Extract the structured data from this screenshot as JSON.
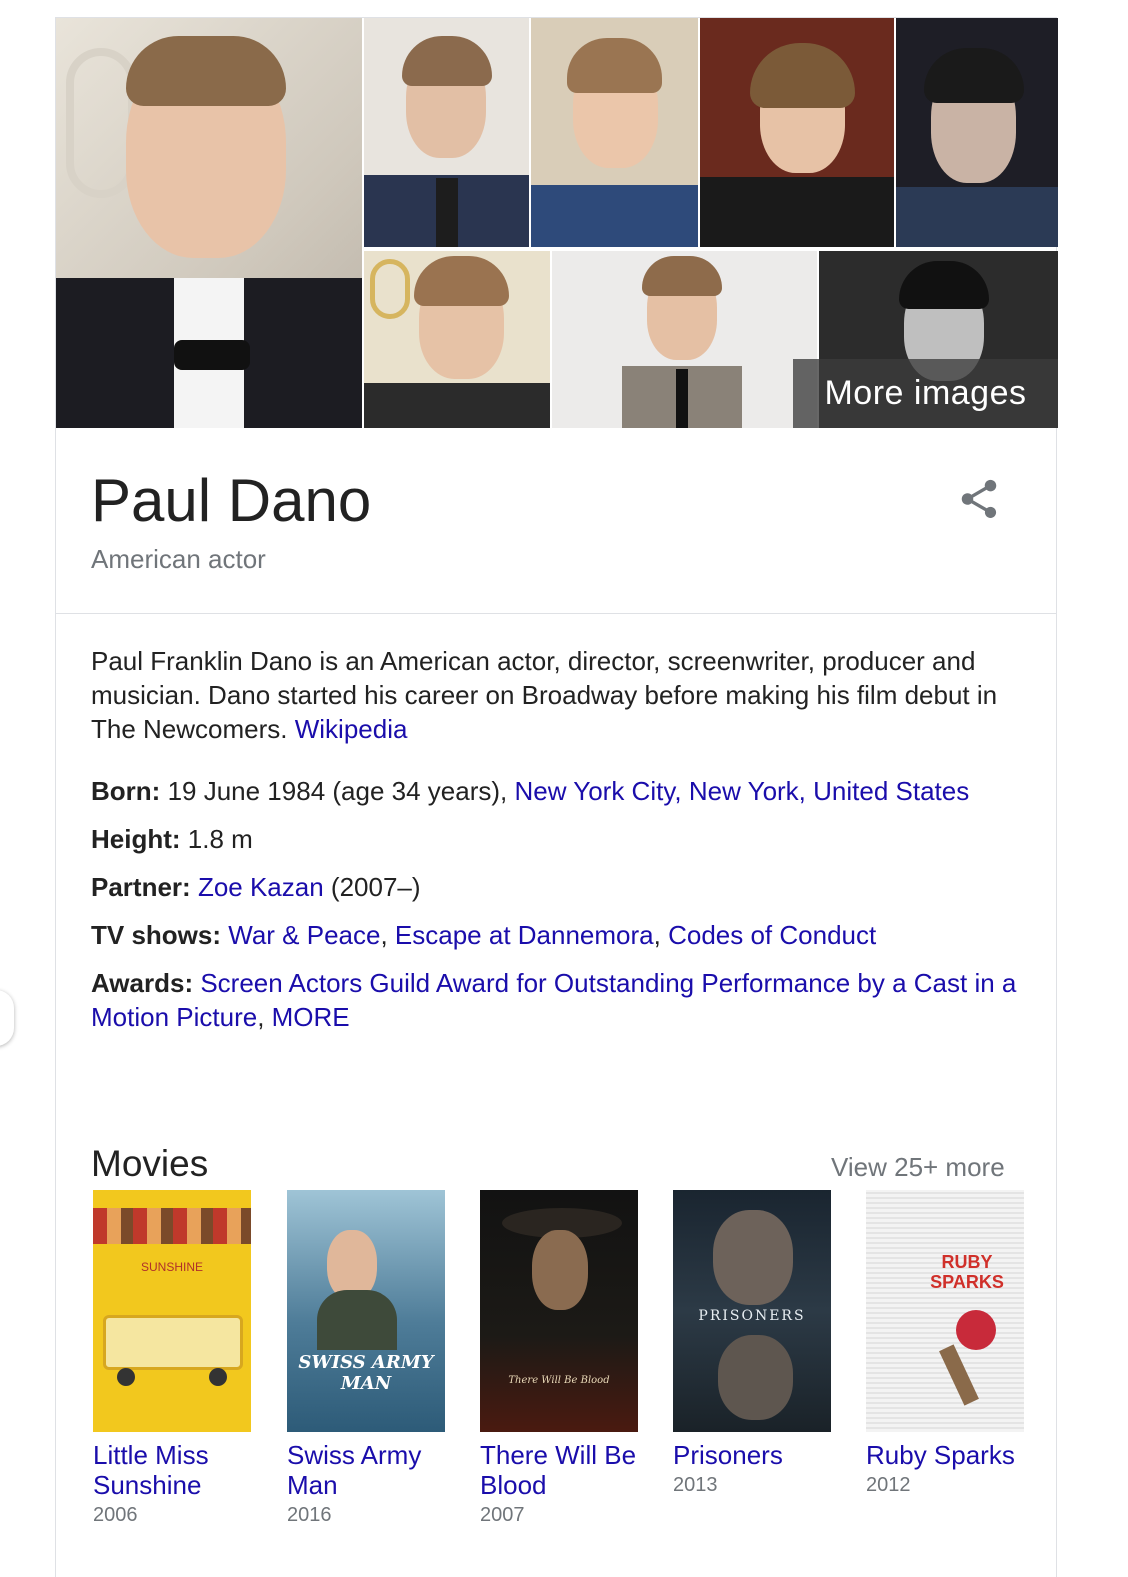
{
  "images": {
    "more_images_label": "More images"
  },
  "header": {
    "name": "Paul Dano",
    "subtitle": "American actor"
  },
  "description": {
    "text": "Paul Franklin Dano is an American actor, director, screenwriter, producer and musician. Dano started his career on Broadway before making his film debut in The Newcomers.",
    "source_link": "Wikipedia"
  },
  "facts": {
    "born": {
      "label": "Born:",
      "value": "19 June 1984 (age 34 years),",
      "link": "New York City, New York, United States"
    },
    "height": {
      "label": "Height:",
      "value": "1.8 m"
    },
    "partner": {
      "label": "Partner:",
      "link": "Zoe Kazan",
      "value": "(2007–)"
    },
    "tv_shows": {
      "label": "TV shows:",
      "items": [
        "War & Peace",
        "Escape at Dannemora",
        "Codes of Conduct"
      ]
    },
    "awards": {
      "label": "Awards:",
      "link": "Screen Actors Guild Award for Outstanding Performance by a Cast in a Motion Picture",
      "more": "MORE"
    }
  },
  "movies": {
    "title": "Movies",
    "view_more": "View 25+ more",
    "items": [
      {
        "title": "Little Miss Sunshine",
        "year": "2006",
        "poster_text": "SUNSHINE"
      },
      {
        "title": "Swiss Army Man",
        "year": "2016",
        "poster_text": "SWISS ARMY MAN"
      },
      {
        "title": "There Will Be Blood",
        "year": "2007",
        "poster_text": "There Will Be Blood"
      },
      {
        "title": "Prisoners",
        "year": "2013",
        "poster_text": "PRISONERS"
      },
      {
        "title": "Ruby Sparks",
        "year": "2012",
        "poster_text": "RUBY SPARKS"
      }
    ]
  },
  "colors": {
    "link": "#1a0dab",
    "secondary_text": "#70757a",
    "primary_text": "#222222",
    "border": "#dfe1e5"
  }
}
